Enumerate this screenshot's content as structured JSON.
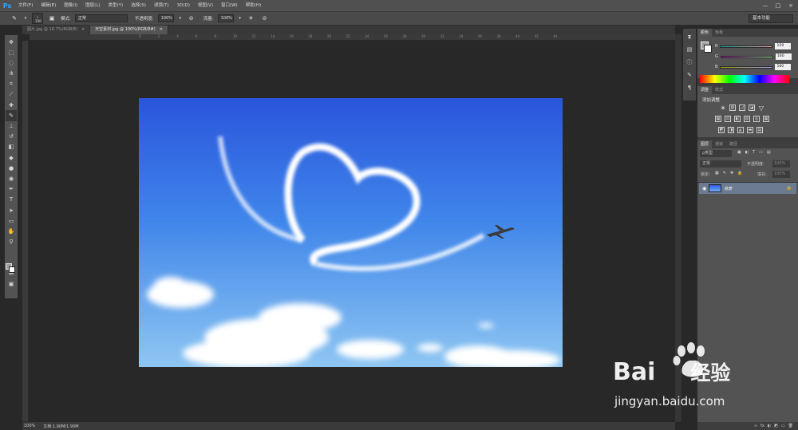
{
  "app": {
    "logo": "Ps"
  },
  "menu": [
    "文件(F)",
    "编辑(E)",
    "图像(I)",
    "图层(L)",
    "类型(Y)",
    "选择(S)",
    "滤镜(T)",
    "3D(D)",
    "视图(V)",
    "窗口(W)",
    "帮助(H)"
  ],
  "window_controls": [
    "—",
    "□",
    "×"
  ],
  "options": {
    "brush_size": "150",
    "mode_label": "模式:",
    "mode_value": "正常",
    "opacity_label": "不透明度:",
    "opacity_value": "100%",
    "flow_label": "流量:",
    "flow_value": "100%",
    "workspace": "基本功能"
  },
  "tabs": [
    {
      "label": "图片.jpg @ 16.7%(RGB/8)",
      "close": "×",
      "active": false
    },
    {
      "label": "天空素材.jpg @ 100%(RGB/8#)",
      "close": "×",
      "active": true
    }
  ],
  "tools": [
    {
      "name": "move-tool-icon",
      "glyph": "✥"
    },
    {
      "name": "marquee-tool-icon",
      "glyph": "⬚"
    },
    {
      "name": "lasso-tool-icon",
      "glyph": "◌"
    },
    {
      "name": "quick-select-tool-icon",
      "glyph": "⋔"
    },
    {
      "name": "crop-tool-icon",
      "glyph": "⌗"
    },
    {
      "name": "eyedropper-tool-icon",
      "glyph": "⟋"
    },
    {
      "name": "healing-tool-icon",
      "glyph": "✚"
    },
    {
      "name": "brush-tool-icon",
      "glyph": "✎"
    },
    {
      "name": "stamp-tool-icon",
      "glyph": "⊥"
    },
    {
      "name": "history-brush-tool-icon",
      "glyph": "↺"
    },
    {
      "name": "eraser-tool-icon",
      "glyph": "◧"
    },
    {
      "name": "paint-bucket-tool-icon",
      "glyph": "◆"
    },
    {
      "name": "blur-tool-icon",
      "glyph": "●"
    },
    {
      "name": "dodge-tool-icon",
      "glyph": "◉"
    },
    {
      "name": "pen-tool-icon",
      "glyph": "✒"
    },
    {
      "name": "type-tool-icon",
      "glyph": "T"
    },
    {
      "name": "path-select-tool-icon",
      "glyph": "➤"
    },
    {
      "name": "shape-tool-icon",
      "glyph": "▭"
    },
    {
      "name": "hand-tool-icon",
      "glyph": "✋"
    },
    {
      "name": "zoom-tool-icon",
      "glyph": "⚲"
    }
  ],
  "ruler_ticks": [
    "0",
    "2",
    "4",
    "6",
    "8",
    "10",
    "12",
    "14",
    "16",
    "18",
    "20",
    "22",
    "24",
    "26",
    "28",
    "30",
    "32",
    "34",
    "36",
    "38",
    "40",
    "42",
    "44"
  ],
  "status": {
    "zoom": "100%",
    "doc": "文档:1.90M/1.90M"
  },
  "color_panel": {
    "tabs": [
      "颜色",
      "色板"
    ],
    "r_label": "R",
    "r": "159",
    "g_label": "G",
    "g": "160",
    "b_label": "B",
    "b": "160"
  },
  "adjustments_panel": {
    "tabs": [
      "调整",
      "样式"
    ],
    "title": "添加调整"
  },
  "layers_panel": {
    "tabs": [
      "图层",
      "通道",
      "路径"
    ],
    "kind": "ρ类型",
    "blend": "正常",
    "opacity_label": "不透明度:",
    "opacity": "100%",
    "lock_label": "锁定:",
    "fill_label": "填充:",
    "fill": "100%",
    "layer_name": "背景",
    "bottom_icons": [
      "∞",
      "fx",
      "◐",
      "◩",
      "▭",
      "🗑"
    ]
  },
  "watermark": {
    "logo_text": "Bai",
    "logo_text2": "经验",
    "url": "jingyan.baidu.com"
  }
}
